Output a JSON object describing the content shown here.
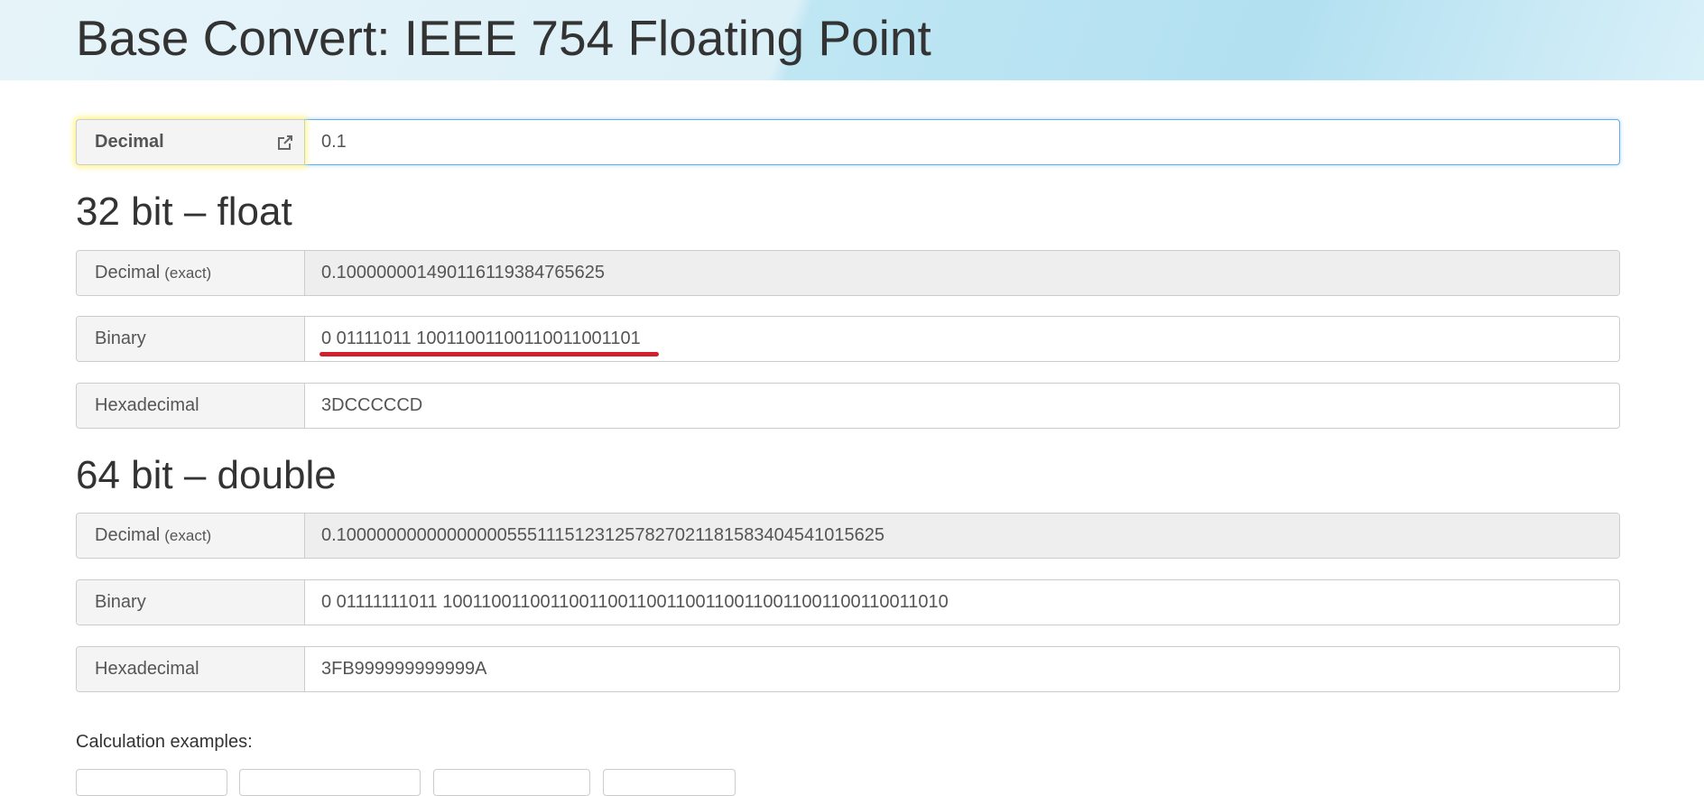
{
  "header": {
    "title": "Base Convert: IEEE 754 Floating Point"
  },
  "input": {
    "label": "Decimal",
    "value": "0.1"
  },
  "float32": {
    "heading": "32 bit – float",
    "decimal_label": "Decimal",
    "decimal_sub": "(exact)",
    "decimal_value": "0.100000001490116119384765625",
    "binary_label": "Binary",
    "binary_value": "0 01111011 10011001100110011001101",
    "hex_label": "Hexadecimal",
    "hex_value": "3DCCCCCD"
  },
  "float64": {
    "heading": "64 bit – double",
    "decimal_label": "Decimal",
    "decimal_sub": "(exact)",
    "decimal_value": "0.1000000000000000055511151231257827021181583404541015625",
    "binary_label": "Binary",
    "binary_value": "0 01111111011 1001100110011001100110011001100110011001100110011010",
    "hex_label": "Hexadecimal",
    "hex_value": "3FB999999999999A"
  },
  "examples": {
    "title": "Calculation examples:"
  },
  "colors": {
    "highlight_underline": "#d11f2c",
    "focus_border": "#66afe9"
  },
  "icons": {
    "open_link": "external-link-icon"
  }
}
